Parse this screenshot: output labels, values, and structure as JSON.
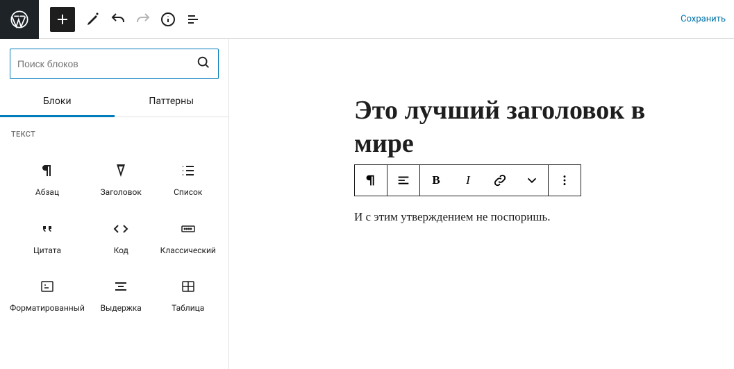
{
  "topbar": {
    "save_label": "Сохранить"
  },
  "inserter": {
    "search_placeholder": "Поиск блоков",
    "tabs": {
      "blocks": "Блоки",
      "patterns": "Паттерны"
    },
    "category_label": "ТЕКСТ",
    "blocks": {
      "paragraph": "Абзац",
      "heading": "Заголовок",
      "list": "Список",
      "quote": "Цитата",
      "code": "Код",
      "classic": "Классический",
      "preformatted": "Форматированный",
      "pullquote": "Выдержка",
      "table": "Таблица"
    }
  },
  "editor": {
    "title": "Это лучший заголовок в мире",
    "paragraph": "И с этим утверждением не поспоришь.",
    "toolbar": {
      "bold": "B",
      "italic": "I"
    }
  }
}
